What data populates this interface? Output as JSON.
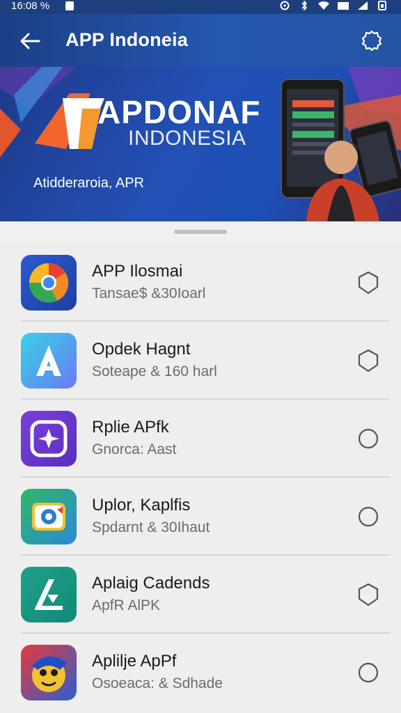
{
  "status_bar": {
    "time": "16:08 %"
  },
  "app_bar": {
    "title": "APP Indoneia"
  },
  "banner": {
    "logo_letters": "APDONAF",
    "logo_sub": "INDONESIA",
    "tagline": "Atidderaroia, APR"
  },
  "apps": [
    {
      "name": "APP Ilosmai",
      "subtitle": "Tansae$ &30Ioarl",
      "icon": "chrome-like-icon"
    },
    {
      "name": "Opdek Hagnt",
      "subtitle": "Soteape & 160 harl",
      "icon": "letter-a-icon"
    },
    {
      "name": "Rplie APfk",
      "subtitle": "Gnorca: Aast",
      "icon": "star-icon"
    },
    {
      "name": "Uplor, Kaplfis",
      "subtitle": "Spdarnt & 30Ihaut",
      "icon": "camera-icon"
    },
    {
      "name": "Aplaig Cadends",
      "subtitle": "ApfR AlPK",
      "icon": "letter-a-arrow-icon"
    },
    {
      "name": "Aplilje ApPf",
      "subtitle": "Osoeaca: & Sdhade",
      "icon": "bird-mascot-icon"
    }
  ],
  "colors": {
    "appbar": "#1c3f86",
    "banner": "#2350b5",
    "list_bg": "#eeeeee"
  }
}
